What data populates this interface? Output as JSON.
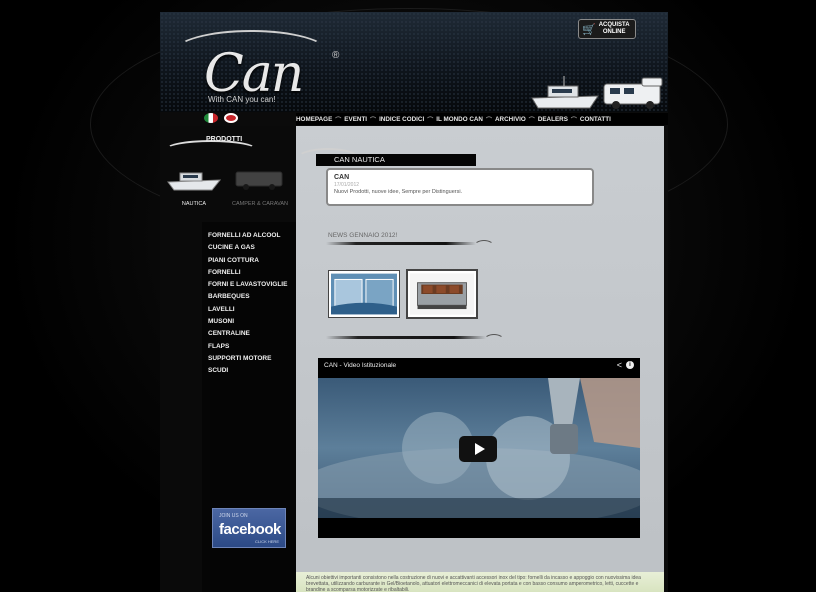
{
  "header": {
    "logo_text": "Can",
    "logo_reg": "®",
    "tagline": "With CAN you can!",
    "buy_button": {
      "line1": "ACQUISTA",
      "line2": "ONLINE",
      "icon": "cart-icon"
    }
  },
  "languages": [
    {
      "name": "italian-flag-icon"
    },
    {
      "name": "uk-flag-icon"
    }
  ],
  "topnav": {
    "items": [
      "HOMEPAGE",
      "EVENTI",
      "INDICE CODICI",
      "IL MONDO CAN",
      "ARCHIVIO",
      "DEALERS",
      "CONTATTI"
    ]
  },
  "sidebar": {
    "section_label": "PRODOTTI",
    "categories": [
      {
        "label": "NAUTICA",
        "icon": "boat-icon",
        "active": true
      },
      {
        "label": "CAMPER & CARAVAN",
        "icon": "camper-icon",
        "active": false
      }
    ],
    "menu": [
      "FORNELLI AD ALCOOL",
      "CUCINE A GAS",
      "PIANI COTTURA",
      "FORNELLI",
      "FORNI E LAVASTOVIGLIE",
      "BARBEQUES",
      "LAVELLI",
      "MUSONI",
      "CENTRALINE",
      "FLAPS",
      "SUPPORTI MOTORE",
      "SCUDI"
    ],
    "facebook": {
      "small": "JOIN US ON",
      "big": "facebook",
      "tiny": "CLICK HERE"
    }
  },
  "content": {
    "section_title": "CAN NAUTICA",
    "news": {
      "title": "CAN",
      "date": "17/01/2012",
      "text": "Nuovi Prodotti, nuove idee, Sempre per Distinguersi."
    },
    "news_label": "NEWS GENNAIO 2012!",
    "video": {
      "title": "CAN - Video Istituzionale",
      "share_icon": "share-icon",
      "info_icon": "info-icon"
    },
    "paragraph": "Alcuni obiettivi importanti consistono nella costruzione di nuovi e accattivanti accessori inox del tipo: fornelli da incasso e appoggio con nuovissima idea brevettata, utilizzando carburante in Gel/Bioetanolo, attuatori elettromeccanici di elevata portata e con basso consumo amperometrico, letti, cuccette e brandine a scomparsa motorizzate e ribaltabili."
  },
  "colors": {
    "nav_bg": "#000000",
    "content_bg": "#c9cdd1",
    "fb_blue": "#3b5998"
  }
}
